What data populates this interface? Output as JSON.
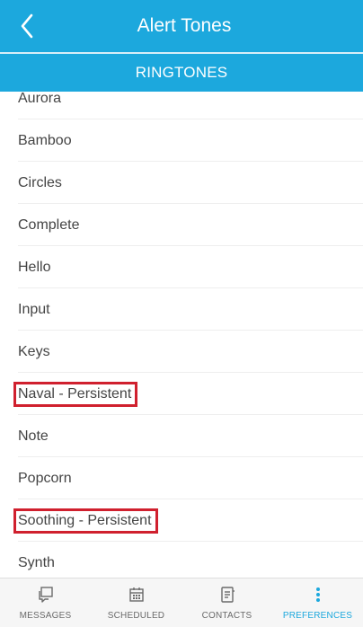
{
  "header": {
    "title": "Alert Tones",
    "back_icon": "chevron-left-icon"
  },
  "section": {
    "label": "RINGTONES"
  },
  "ringtones": [
    {
      "label": "Aurora",
      "highlighted": false
    },
    {
      "label": "Bamboo",
      "highlighted": false
    },
    {
      "label": "Circles",
      "highlighted": false
    },
    {
      "label": "Complete",
      "highlighted": false
    },
    {
      "label": "Hello",
      "highlighted": false
    },
    {
      "label": "Input",
      "highlighted": false
    },
    {
      "label": "Keys",
      "highlighted": false
    },
    {
      "label": "Naval - Persistent",
      "highlighted": true
    },
    {
      "label": "Note",
      "highlighted": false
    },
    {
      "label": "Popcorn",
      "highlighted": false
    },
    {
      "label": "Soothing - Persistent",
      "highlighted": true
    },
    {
      "label": "Synth",
      "highlighted": false
    }
  ],
  "tabbar": {
    "tabs": [
      {
        "label": "MESSAGES",
        "icon": "messages-icon",
        "active": false
      },
      {
        "label": "SCHEDULED",
        "icon": "calendar-icon",
        "active": false
      },
      {
        "label": "CONTACTS",
        "icon": "contacts-icon",
        "active": false
      },
      {
        "label": "PREFERENCES",
        "icon": "preferences-icon",
        "active": true
      }
    ]
  },
  "colors": {
    "accent": "#1ca8dd",
    "highlight_box": "#d0202e",
    "tab_inactive": "#6a6a6a"
  }
}
